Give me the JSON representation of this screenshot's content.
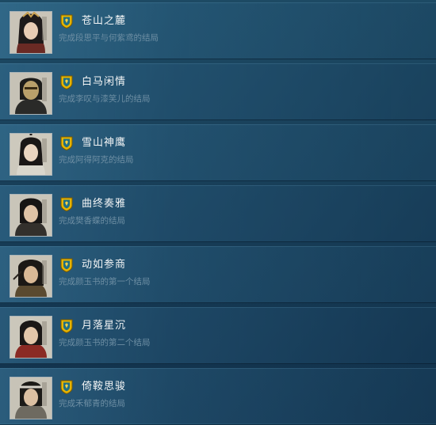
{
  "achievements": [
    {
      "title": "苍山之麓",
      "description": "完成段思平与何紫鸢的结局",
      "icon": "achievement-badge-icon",
      "portrait": "female-character-portrait"
    },
    {
      "title": "白马闲情",
      "description": "完成李叹与漆笑儿的结局",
      "icon": "achievement-badge-icon",
      "portrait": "masked-character-portrait"
    },
    {
      "title": "雪山神鹰",
      "description": "完成阿得阿克的结局",
      "icon": "achievement-badge-icon",
      "portrait": "female-character-portrait"
    },
    {
      "title": "曲终奏雅",
      "description": "完成樊香蝶的结局",
      "icon": "achievement-badge-icon",
      "portrait": "male-character-portrait"
    },
    {
      "title": "动如参商",
      "description": "完成颜玉书的第一个结局",
      "icon": "achievement-badge-icon",
      "portrait": "male-character-portrait"
    },
    {
      "title": "月落星沉",
      "description": "完成颜玉书的第二个结局",
      "icon": "achievement-badge-icon",
      "portrait": "male-character-portrait"
    },
    {
      "title": "倚鞍思骏",
      "description": "完成禾郁青的结局",
      "icon": "achievement-badge-icon",
      "portrait": "male-character-portrait"
    }
  ],
  "colors": {
    "title": "#f2f4f5",
    "description": "#6d8ea3",
    "badge_gold": "#e6b400",
    "background": "#173d57"
  }
}
